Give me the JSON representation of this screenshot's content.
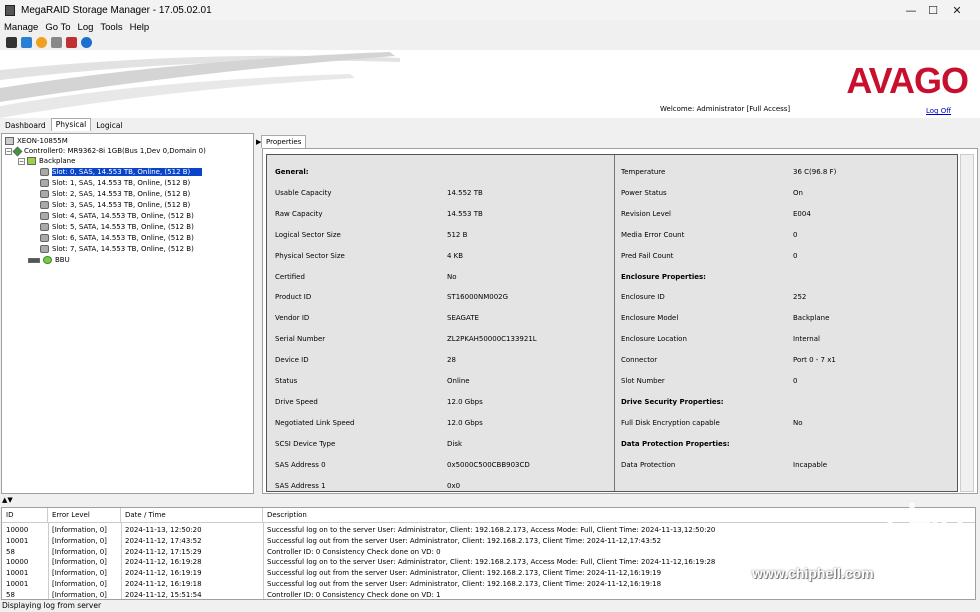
{
  "window": {
    "title": "MegaRAID Storage Manager - 17.05.02.01",
    "minimize": "—",
    "maximize": "☐",
    "close": "✕"
  },
  "menu": [
    "Manage",
    "Go To",
    "Log",
    "Tools",
    "Help"
  ],
  "toolbar_icons": [
    "server-icon",
    "refresh-icon",
    "config-icon",
    "delete-icon",
    "exit-icon",
    "help-icon"
  ],
  "banner": {
    "logo": "AVAGO",
    "welcome": "Welcome: Administrator [Full Access]",
    "logoff": "Log Off"
  },
  "tabs": [
    "Dashboard",
    "Physical",
    "Logical"
  ],
  "tree": {
    "host": "XEON-10855M",
    "controller": "Controller0: MR9362-8i 1GB(Bus 1,Dev 0,Domain 0)",
    "backplane": "Backplane",
    "slots": [
      "Slot: 0, SAS, 14.553 TB, Online, (512 B)",
      "Slot: 1, SAS, 14.553 TB, Online, (512 B)",
      "Slot: 2, SAS, 14.553 TB, Online, (512 B)",
      "Slot: 3, SAS, 14.553 TB, Online, (512 B)",
      "Slot: 4, SATA, 14.553 TB, Online, (512 B)",
      "Slot: 5, SATA, 14.553 TB, Online, (512 B)",
      "Slot: 6, SATA, 14.553 TB, Online, (512 B)",
      "Slot: 7, SATA, 14.553 TB, Online, (512 B)"
    ],
    "bbu": "BBU"
  },
  "properties": {
    "tab": "Properties",
    "left": [
      {
        "label": "General:",
        "value": "",
        "head": true
      },
      {
        "label": "Usable Capacity",
        "value": "14.552 TB"
      },
      {
        "label": "Raw Capacity",
        "value": "14.553 TB"
      },
      {
        "label": "Logical Sector Size",
        "value": "512 B"
      },
      {
        "label": "Physical Sector Size",
        "value": "4 KB"
      },
      {
        "label": "Certified",
        "value": "No"
      },
      {
        "label": "Product ID",
        "value": "ST16000NM002G"
      },
      {
        "label": "Vendor ID",
        "value": "SEAGATE"
      },
      {
        "label": "Serial Number",
        "value": "ZL2PKAH50000C133921L"
      },
      {
        "label": "Device ID",
        "value": "28"
      },
      {
        "label": "Status",
        "value": "Online"
      },
      {
        "label": "Drive Speed",
        "value": "12.0 Gbps"
      },
      {
        "label": "Negotiated Link Speed",
        "value": "12.0 Gbps"
      },
      {
        "label": "SCSI Device Type",
        "value": "Disk"
      },
      {
        "label": "SAS Address 0",
        "value": "0x5000C500CBB903CD"
      },
      {
        "label": "SAS Address 1",
        "value": "0x0"
      }
    ],
    "right": [
      {
        "label": "Temperature",
        "value": "36 C(96.8 F)"
      },
      {
        "label": "Power Status",
        "value": "On"
      },
      {
        "label": "Revision Level",
        "value": "E004"
      },
      {
        "label": "Media Error Count",
        "value": "0"
      },
      {
        "label": "Pred Fail Count",
        "value": "0"
      },
      {
        "label": "Enclosure Properties:",
        "value": "",
        "head": true
      },
      {
        "label": "Enclosure ID",
        "value": "252"
      },
      {
        "label": "Enclosure Model",
        "value": "Backplane"
      },
      {
        "label": "Enclosure Location",
        "value": "Internal"
      },
      {
        "label": "Connector",
        "value": "Port 0 - 7 x1"
      },
      {
        "label": "Slot Number",
        "value": "0"
      },
      {
        "label": "Drive Security Properties:",
        "value": "",
        "head": true
      },
      {
        "label": "Full Disk Encryption capable",
        "value": "No"
      },
      {
        "label": "Data Protection Properties:",
        "value": "",
        "head": true
      },
      {
        "label": "Data Protection",
        "value": "Incapable"
      }
    ]
  },
  "log": {
    "headers": [
      "ID",
      "Error Level",
      "Date / Time",
      "Description"
    ],
    "rows": [
      [
        "10000",
        "[Information, 0]",
        "2024-11-13, 12:50:20",
        "Successful log on to the server User:  Administrator, Client:  192.168.2.173,    Access Mode:  Full, Client Time:  2024-11-13,12:50:20"
      ],
      [
        "10001",
        "[Information, 0]",
        "2024-11-12, 17:43:52",
        "Successful log out from the server User:  Administrator, Client:  192.168.2.173,    Client Time:  2024-11-12,17:43:52"
      ],
      [
        "58",
        "[Information, 0]",
        "2024-11-12, 17:15:29",
        "Controller ID:  0   Consistency Check done on VD:   0"
      ],
      [
        "10000",
        "[Information, 0]",
        "2024-11-12, 16:19:28",
        "Successful log on to the server User:  Administrator, Client:  192.168.2.173,    Access Mode:  Full, Client Time:  2024-11-12,16:19:28"
      ],
      [
        "10001",
        "[Information, 0]",
        "2024-11-12, 16:19:19",
        "Successful log out from the server User:  Administrator, Client:  192.168.2.173,    Client Time:  2024-11-12,16:19:19"
      ],
      [
        "10001",
        "[Information, 0]",
        "2024-11-12, 16:19:18",
        "Successful log out from the server User:  Administrator, Client:  192.168.2.173,    Client Time:  2024-11-12,16:19:18"
      ],
      [
        "58",
        "[Information, 0]",
        "2024-11-12, 15:51:54",
        "Controller ID:  0   Consistency Check done on VD:   1"
      ]
    ]
  },
  "status": "Displaying log from server",
  "watermark": "www.chiphell.com",
  "colors": {
    "selection": "#0a44c8",
    "logo": "#c8102e",
    "link": "#0000cc"
  }
}
